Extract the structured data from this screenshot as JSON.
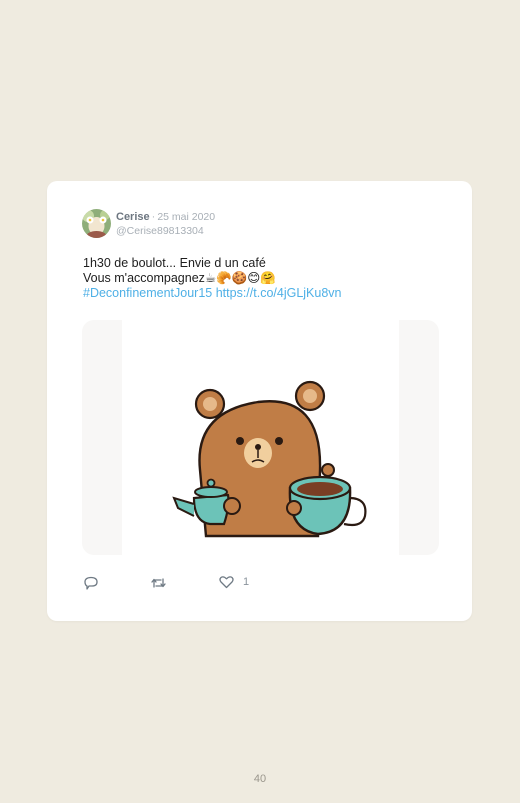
{
  "tweet": {
    "author_name": "Cerise",
    "separator": "·",
    "date": "25 mai 2020",
    "handle": "@Cerise89813304",
    "text_line1": "1h30 de boulot... Envie d un café",
    "text_line2": "Vous m'accompagnez☕🥐🍪😊🤗",
    "hashtag": "#DeconfinementJour15",
    "link": "https://t.co/4jGLjKu8vn",
    "media_alt": "bear-with-teapot-and-cup-gif",
    "likes": "1"
  },
  "actions": {
    "reply_icon": "reply-icon",
    "retweet_icon": "retweet-icon",
    "like_icon": "heart-icon"
  },
  "page": {
    "number": "40"
  },
  "colors": {
    "background": "#efebe0",
    "card": "#ffffff",
    "link_blue": "#4fb0e6",
    "bear_brown": "#c07d46",
    "teapot_teal": "#6cc3b8"
  }
}
